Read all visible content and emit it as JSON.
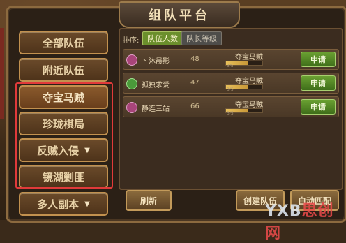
{
  "window": {
    "title": "组队平台"
  },
  "sidebar": {
    "items": [
      {
        "label": "全部队伍",
        "has_arrow": false
      },
      {
        "label": "附近队伍",
        "has_arrow": false
      },
      {
        "label": "夺宝马贼",
        "has_arrow": false
      },
      {
        "label": "珍珑棋局",
        "has_arrow": false
      },
      {
        "label": "反贼入侵",
        "has_arrow": true
      },
      {
        "label": "镜湖剿匪",
        "has_arrow": false
      },
      {
        "label": "多人副本",
        "has_arrow": true
      }
    ]
  },
  "sort": {
    "label": "排序:",
    "tabs": [
      {
        "label": "队伍人数",
        "active": true
      },
      {
        "label": "队长等级",
        "active": false
      }
    ]
  },
  "teams": [
    {
      "name": "丶沐晨影",
      "level": "48",
      "goal": "夺宝马贼",
      "count": "3/5",
      "fill": 0.6,
      "icon_color": "#a8457a",
      "apply_label": "申请"
    },
    {
      "name": "孤独求爱",
      "level": "47",
      "goal": "夺宝马贼",
      "count": "3/5",
      "fill": 0.6,
      "icon_color": "#4a9a3a",
      "apply_label": "申请"
    },
    {
      "name": "静连三站",
      "level": "66",
      "goal": "夺宝马贼",
      "count": "3/5",
      "fill": 0.6,
      "icon_color": "#a8457a",
      "apply_label": "申请"
    }
  ],
  "footer": {
    "refresh_label": "刷新",
    "create_label": "创建队伍",
    "auto_label": "自动匹配"
  },
  "watermark": {
    "latin": "YXB",
    "cn": "思创网"
  },
  "colors": {
    "accent_green": "#6aa032",
    "highlight_red": "#e03a3a",
    "panel_brown": "#3b2c1f"
  }
}
